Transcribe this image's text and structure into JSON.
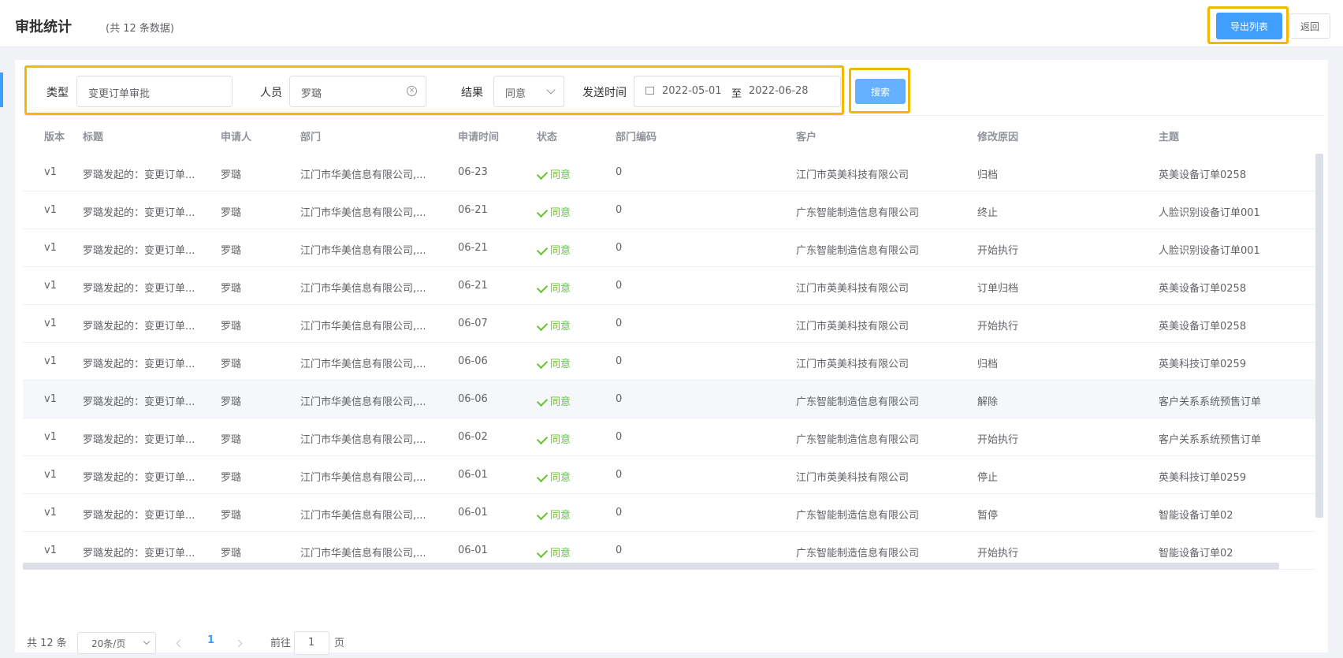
{
  "header": {
    "title": "审批统计",
    "count_text": "(共 12 条数据)",
    "export_label": "导出列表",
    "back_label": "返回"
  },
  "filters": {
    "type_label": "类型",
    "type_value": "变更订单审批",
    "person_label": "人员",
    "person_value": "罗璐",
    "result_label": "结果",
    "result_value": "同意",
    "time_label": "发送时间",
    "date_start": "2022-05-01",
    "date_sep": "至",
    "date_end": "2022-06-28",
    "search_label": "搜索"
  },
  "table": {
    "columns": [
      "版本",
      "标题",
      "申请人",
      "部门",
      "申请时间",
      "状态",
      "部门编码",
      "客户",
      "修改原因",
      "主题"
    ],
    "rows": [
      [
        "v1",
        "罗璐发起的：变更订单...",
        "罗璐",
        "江门市华美信息有限公司,...",
        "06-23",
        "同意",
        "0",
        "江门市英美科技有限公司",
        "归档",
        "英美设备订单0258"
      ],
      [
        "v1",
        "罗璐发起的：变更订单...",
        "罗璐",
        "江门市华美信息有限公司,...",
        "06-21",
        "同意",
        "0",
        "广东智能制造信息有限公司",
        "终止",
        "人脸识别设备订单001"
      ],
      [
        "v1",
        "罗璐发起的：变更订单...",
        "罗璐",
        "江门市华美信息有限公司,...",
        "06-21",
        "同意",
        "0",
        "广东智能制造信息有限公司",
        "开始执行",
        "人脸识别设备订单001"
      ],
      [
        "v1",
        "罗璐发起的：变更订单...",
        "罗璐",
        "江门市华美信息有限公司,...",
        "06-21",
        "同意",
        "0",
        "江门市英美科技有限公司",
        "订单归档",
        "英美设备订单0258"
      ],
      [
        "v1",
        "罗璐发起的：变更订单...",
        "罗璐",
        "江门市华美信息有限公司,...",
        "06-07",
        "同意",
        "0",
        "江门市英美科技有限公司",
        "开始执行",
        "英美设备订单0258"
      ],
      [
        "v1",
        "罗璐发起的：变更订单...",
        "罗璐",
        "江门市华美信息有限公司,...",
        "06-06",
        "同意",
        "0",
        "江门市英美科技有限公司",
        "归档",
        "英美科技订单0259"
      ],
      [
        "v1",
        "罗璐发起的：变更订单...",
        "罗璐",
        "江门市华美信息有限公司,...",
        "06-06",
        "同意",
        "0",
        "广东智能制造信息有限公司",
        "解除",
        "客户关系系统预售订单"
      ],
      [
        "v1",
        "罗璐发起的：变更订单...",
        "罗璐",
        "江门市华美信息有限公司,...",
        "06-02",
        "同意",
        "0",
        "广东智能制造信息有限公司",
        "开始执行",
        "客户关系系统预售订单"
      ],
      [
        "v1",
        "罗璐发起的：变更订单...",
        "罗璐",
        "江门市华美信息有限公司,...",
        "06-01",
        "同意",
        "0",
        "江门市英美科技有限公司",
        "停止",
        "英美科技订单0259"
      ],
      [
        "v1",
        "罗璐发起的：变更订单...",
        "罗璐",
        "江门市华美信息有限公司,...",
        "06-01",
        "同意",
        "0",
        "广东智能制造信息有限公司",
        "暂停",
        "智能设备订单02"
      ],
      [
        "v1",
        "罗璐发起的：变更订单...",
        "罗璐",
        "江门市华美信息有限公司,...",
        "06-01",
        "同意",
        "0",
        "广东智能制造信息有限公司",
        "开始执行",
        "智能设备订单02"
      ]
    ]
  },
  "pagination": {
    "total_text": "共 12 条",
    "page_size": "20条/页",
    "current_page": "1",
    "goto_label": "前往",
    "goto_value": "1",
    "page_suffix": "页"
  },
  "colors": {
    "primary": "#409eff",
    "success": "#67c23a",
    "highlight_frame": "#f5b800"
  }
}
